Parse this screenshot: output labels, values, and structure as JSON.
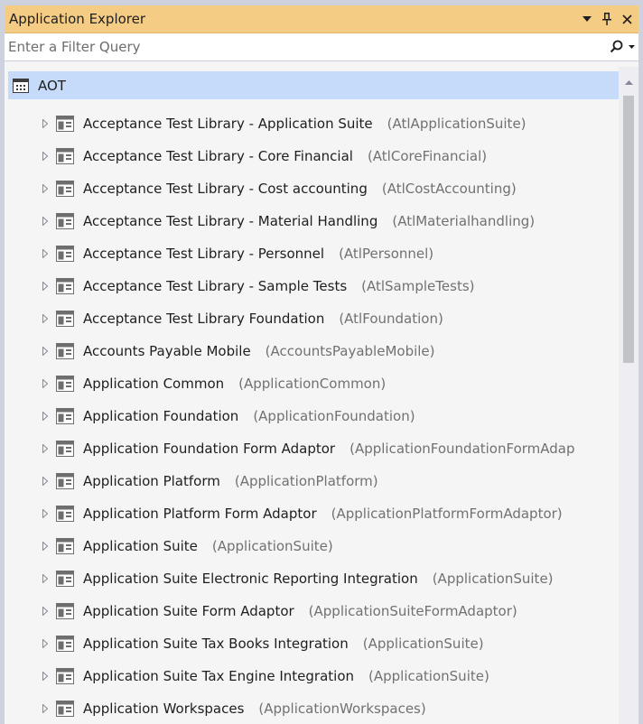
{
  "window": {
    "title": "Application Explorer",
    "buttons": {
      "dropdown": "▾",
      "pin": "⊥",
      "close": "✕"
    }
  },
  "filter": {
    "placeholder": "Enter a Filter Query",
    "value": "",
    "search_icon": "search-icon"
  },
  "tree": {
    "root": {
      "label": "AOT",
      "icon": "aot-icon",
      "selected": true
    },
    "items": [
      {
        "name": "Acceptance Test Library - Application Suite",
        "id": "(AtlApplicationSuite)"
      },
      {
        "name": "Acceptance Test Library - Core Financial",
        "id": "(AtlCoreFinancial)"
      },
      {
        "name": "Acceptance Test Library - Cost accounting",
        "id": "(AtlCostAccounting)"
      },
      {
        "name": "Acceptance Test Library - Material Handling",
        "id": "(AtlMaterialhandling)"
      },
      {
        "name": "Acceptance Test Library - Personnel",
        "id": "(AtlPersonnel)"
      },
      {
        "name": "Acceptance Test Library - Sample Tests",
        "id": "(AtlSampleTests)"
      },
      {
        "name": "Acceptance Test Library Foundation",
        "id": "(AtlFoundation)"
      },
      {
        "name": "Accounts Payable Mobile",
        "id": "(AccountsPayableMobile)"
      },
      {
        "name": "Application Common",
        "id": "(ApplicationCommon)"
      },
      {
        "name": "Application Foundation",
        "id": "(ApplicationFoundation)"
      },
      {
        "name": "Application Foundation Form Adaptor",
        "id": "(ApplicationFoundationFormAdap"
      },
      {
        "name": "Application Platform",
        "id": "(ApplicationPlatform)"
      },
      {
        "name": "Application Platform Form Adaptor",
        "id": "(ApplicationPlatformFormAdaptor)"
      },
      {
        "name": "Application Suite",
        "id": "(ApplicationSuite)"
      },
      {
        "name": "Application Suite Electronic Reporting Integration",
        "id": "(ApplicationSuite)"
      },
      {
        "name": "Application Suite Form Adaptor",
        "id": "(ApplicationSuiteFormAdaptor)"
      },
      {
        "name": "Application Suite Tax Books Integration",
        "id": "(ApplicationSuite)"
      },
      {
        "name": "Application Suite Tax Engine Integration",
        "id": "(ApplicationSuite)"
      },
      {
        "name": "Application Workspaces",
        "id": "(ApplicationWorkspaces)"
      }
    ]
  },
  "colors": {
    "titlebar": "#f5cc84",
    "selection": "#c6dbf9",
    "text": "#1e1e1e",
    "secondary_text": "#717171"
  }
}
